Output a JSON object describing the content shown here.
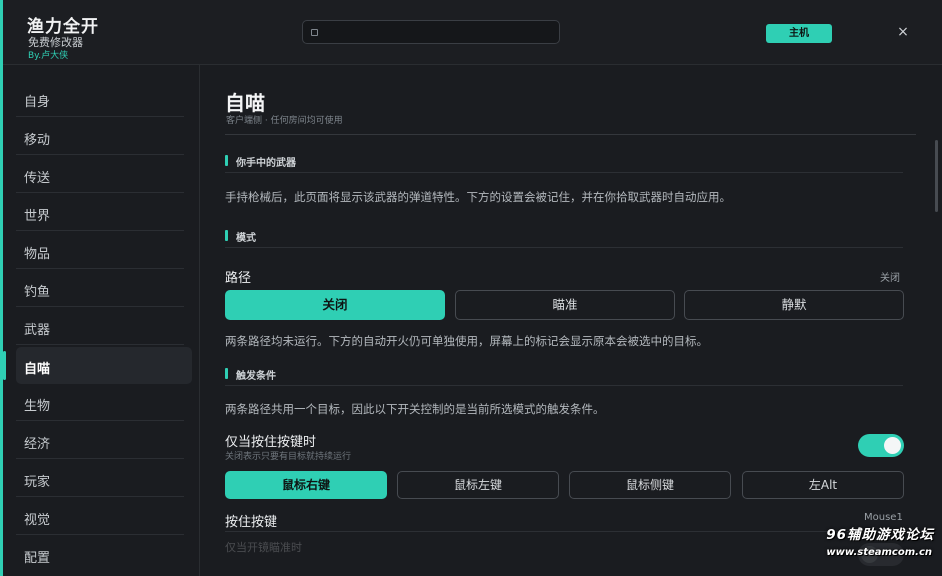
{
  "app": {
    "title": "渔力全开",
    "subtitle": "免费修改器",
    "author": "By.卢大侠",
    "host_button": "主机",
    "close_glyph": "×",
    "search_value": "",
    "accent_color": "#2fcfb4"
  },
  "sidebar": {
    "items": [
      {
        "label": "自身"
      },
      {
        "label": "移动"
      },
      {
        "label": "传送"
      },
      {
        "label": "世界"
      },
      {
        "label": "物品"
      },
      {
        "label": "钓鱼"
      },
      {
        "label": "武器"
      },
      {
        "label": "自喵"
      },
      {
        "label": "生物"
      },
      {
        "label": "经济"
      },
      {
        "label": "玩家"
      },
      {
        "label": "视觉"
      },
      {
        "label": "配置"
      }
    ],
    "active": "自喵"
  },
  "main": {
    "title": "自喵",
    "subtitle": "客户端侧 · 任何房间均可使用",
    "weapon_section": {
      "heading": "你手中的武器",
      "text": "手持枪械后，此页面将显示该武器的弹道特性。下方的设置会被记住，并在你拾取武器时自动应用。"
    },
    "mode_section": {
      "heading": "模式",
      "path_label": "路径",
      "path_value": "关闭",
      "options": [
        "关闭",
        "瞄准",
        "静默"
      ],
      "selected": "关闭",
      "note": "两条路径均未运行。下方的自动开火仍可单独使用，屏幕上的标记会显示原本会被选中的目标。"
    },
    "trigger_section": {
      "heading": "触发条件",
      "text": "两条路径共用一个目标，因此以下开关控制的是当前所选模式的触发条件。",
      "hold_label": "仅当按住按键时",
      "hold_sub": "关闭表示只要有目标就持续运行",
      "hold_enabled": true,
      "keys": [
        "鼠标右键",
        "鼠标左键",
        "鼠标侧键",
        "左Alt"
      ],
      "selected_key": "鼠标右键",
      "hold_key_label": "按住按键",
      "hold_key_value": "Mouse1",
      "faded_label": "仅当开镜瞄准时"
    }
  },
  "watermark": {
    "line1": "96辅助游戏论坛",
    "line2": "www.steamcom.cn"
  }
}
